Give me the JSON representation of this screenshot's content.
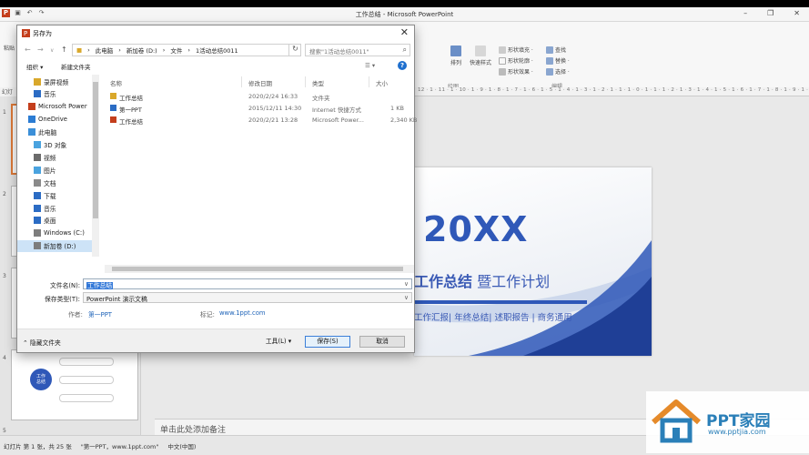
{
  "ppt": {
    "window_title": "工作总结 - Microsoft PowerPoint",
    "left_ruler": "幻灯",
    "ruler_text": "12 · 1 · 11 · 1 · 10 · 1 · 9 · 1 · 8 · 1 · 7 · 1 · 6 · 1 · 5 · 1 · 4 · 1 · 3 · 1 · 2 · 1 · 1 · 1 · 0 · 1 · 1 · 1 · 2 · 1 · 3 · 1 · 4 · 1 · 5 · 1 · 6 · 1 · 7 · 1 · 8 · 1 · 9 · 1 · 10 · 1 · 11 · 1 · 12 ·",
    "ribbon": {
      "paste_label": "粘贴",
      "arrange_label": "排列",
      "quick_styles_label": "快速样式",
      "shape_fill": "形状填充 ·",
      "shape_outline": "形状轮廓 ·",
      "shape_effects": "形状效果 ·",
      "find": "查找",
      "replace": "替换 ·",
      "select": "选择 ·",
      "group_drawing": "绘图",
      "group_editing": "编辑"
    },
    "thumb_numbers": [
      "1",
      "2",
      "3",
      "4",
      "5"
    ],
    "thumb_center_text": "工作\n总结",
    "slide": {
      "big_text": "20XX",
      "subtitle_bold": "工作总结",
      "subtitle_rest": " 暨工作计划",
      "tags": "工作汇报| 年终总结| 述职报告 | 商务通用"
    },
    "notes_placeholder": "单击此处添加备注",
    "status": {
      "slide_info": "幻灯片 第 1 张，共 25 张",
      "theme": "\"第一PPT，www.1ppt.com\"",
      "language": "中文(中国)"
    },
    "watermark": {
      "title": "PPT家园",
      "url": "www.pptjia.com"
    }
  },
  "dialog": {
    "title": "另存为",
    "address": [
      "此电脑",
      "新加卷 (D:)",
      "文件",
      "1活动总结0011"
    ],
    "search_placeholder": "搜索\"1活动总结0011\"",
    "organize": "组织 ▾",
    "new_folder": "新建文件夹",
    "help": "?",
    "nav": [
      {
        "label": "录屏视频",
        "icon": "folder-icon",
        "indent": 1
      },
      {
        "label": "音乐",
        "icon": "music-icon",
        "indent": 1
      },
      {
        "label": "Microsoft Power",
        "icon": "powerpoint-icon",
        "indent": 0
      },
      {
        "label": "OneDrive",
        "icon": "cloud-icon",
        "indent": 0
      },
      {
        "label": "此电脑",
        "icon": "pc-icon",
        "indent": 0
      },
      {
        "label": "3D 对象",
        "icon": "3d-objects-icon",
        "indent": 1
      },
      {
        "label": "视频",
        "icon": "video-icon",
        "indent": 1
      },
      {
        "label": "图片",
        "icon": "pictures-icon",
        "indent": 1
      },
      {
        "label": "文档",
        "icon": "documents-icon",
        "indent": 1
      },
      {
        "label": "下载",
        "icon": "download-icon",
        "indent": 1
      },
      {
        "label": "音乐",
        "icon": "music-icon",
        "indent": 1
      },
      {
        "label": "桌面",
        "icon": "desktop-icon",
        "indent": 1
      },
      {
        "label": "Windows (C:)",
        "icon": "drive-icon",
        "indent": 1
      },
      {
        "label": "新加卷 (D:)",
        "icon": "drive-icon",
        "indent": 1,
        "selected": true
      }
    ],
    "columns": {
      "name": "名称",
      "date": "修改日期",
      "type": "类型",
      "size": "大小"
    },
    "files": [
      {
        "name": "工作总结",
        "date": "2020/2/24 16:33",
        "type": "文件夹",
        "size": "",
        "icon": "folder-icon"
      },
      {
        "name": "第一PPT",
        "date": "2015/12/11 14:30",
        "type": "Internet 快捷方式",
        "size": "1 KB",
        "icon": "shortcut-icon"
      },
      {
        "name": "工作总结",
        "date": "2020/2/21 13:28",
        "type": "Microsoft Power...",
        "size": "2,340 KB",
        "icon": "pptx-file-icon"
      }
    ],
    "filename_label": "文件名(N):",
    "filename_value": "工作总结",
    "filetype_label": "保存类型(T):",
    "filetype_value": "PowerPoint 演示文稿",
    "author_label": "作者:",
    "author_value": "第一PPT",
    "tags_label": "标记:",
    "tags_value": "www.1ppt.com",
    "hide_folders": "隐藏文件夹",
    "tools": "工具(L)",
    "save": "保存(S)",
    "cancel": "取消"
  },
  "colors": {
    "accent": "#2f58b8",
    "selection": "#cde3f7",
    "ppt_brand": "#c43e1c"
  }
}
